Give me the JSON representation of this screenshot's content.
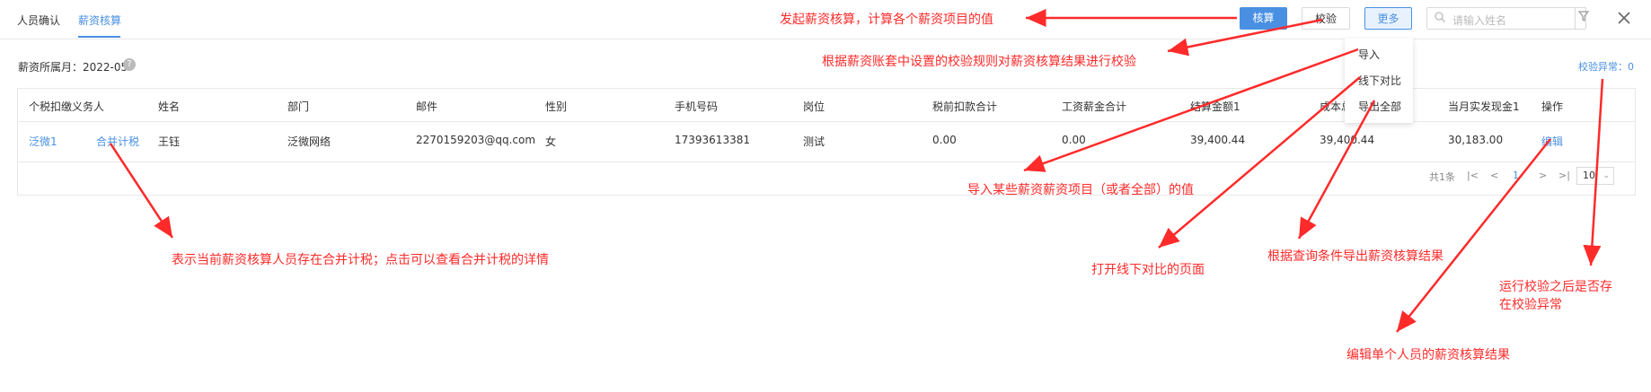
{
  "tabs": [
    {
      "label": "人员确认"
    },
    {
      "label": "薪资核算"
    }
  ],
  "toolbar": {
    "calc_label": "核算",
    "verify_label": "校验",
    "more_label": "更多",
    "search_placeholder": "请输入姓名"
  },
  "more_menu": [
    {
      "label": "导入"
    },
    {
      "label": "线下对比"
    },
    {
      "label": "导出全部"
    }
  ],
  "month": {
    "label": "薪资所属月：2022-05"
  },
  "help": {
    "glyph": "?"
  },
  "verify_status": "校验异常：0",
  "table": {
    "columns": [
      "个税扣缴义务人",
      "姓名",
      "部门",
      "邮件",
      "性别",
      "手机号码",
      "岗位",
      "税前扣款合计",
      "工资薪金合计",
      "结算金额1",
      "成本总",
      "当月实发现金1",
      "操作"
    ],
    "rows": [
      {
        "withholder": "泛微1",
        "merge_tax": "合并计税",
        "name": "王钰",
        "dept": "泛微网络",
        "email": "2270159203@qq.com",
        "gender": "女",
        "phone": "17393613381",
        "post": "测试",
        "pretax_deduction": "0.00",
        "salary_total": "0.00",
        "settle_amount": "39,400.44",
        "cost_total": "39,400.44",
        "cash_paid": "30,183.00",
        "action": "编辑"
      }
    ]
  },
  "pagination": {
    "total": "共1条",
    "first": "|<",
    "prev": "<",
    "page": "1",
    "next": ">",
    "last": ">|",
    "size": "10"
  },
  "annotations": {
    "calc": "发起薪资核算，计算各个薪资项目的值",
    "verify": "根据薪资账套中设置的校验规则对薪资核算结果进行校验",
    "import": "导入某些薪资薪资项目（或者全部）的值",
    "merge": "表示当前薪资核算人员存在合并计税；点击可以查看合并计税的详情",
    "offline": "打开线下对比的页面",
    "export": "根据查询条件导出薪资核算结果",
    "verify_err_1": "运行校验之后是否存",
    "verify_err_2": "在校验异常",
    "edit": "编辑单个人员的薪资核算结果"
  },
  "colors": {
    "accent": "#4a90e2",
    "annotation": "#ff2a2a"
  }
}
